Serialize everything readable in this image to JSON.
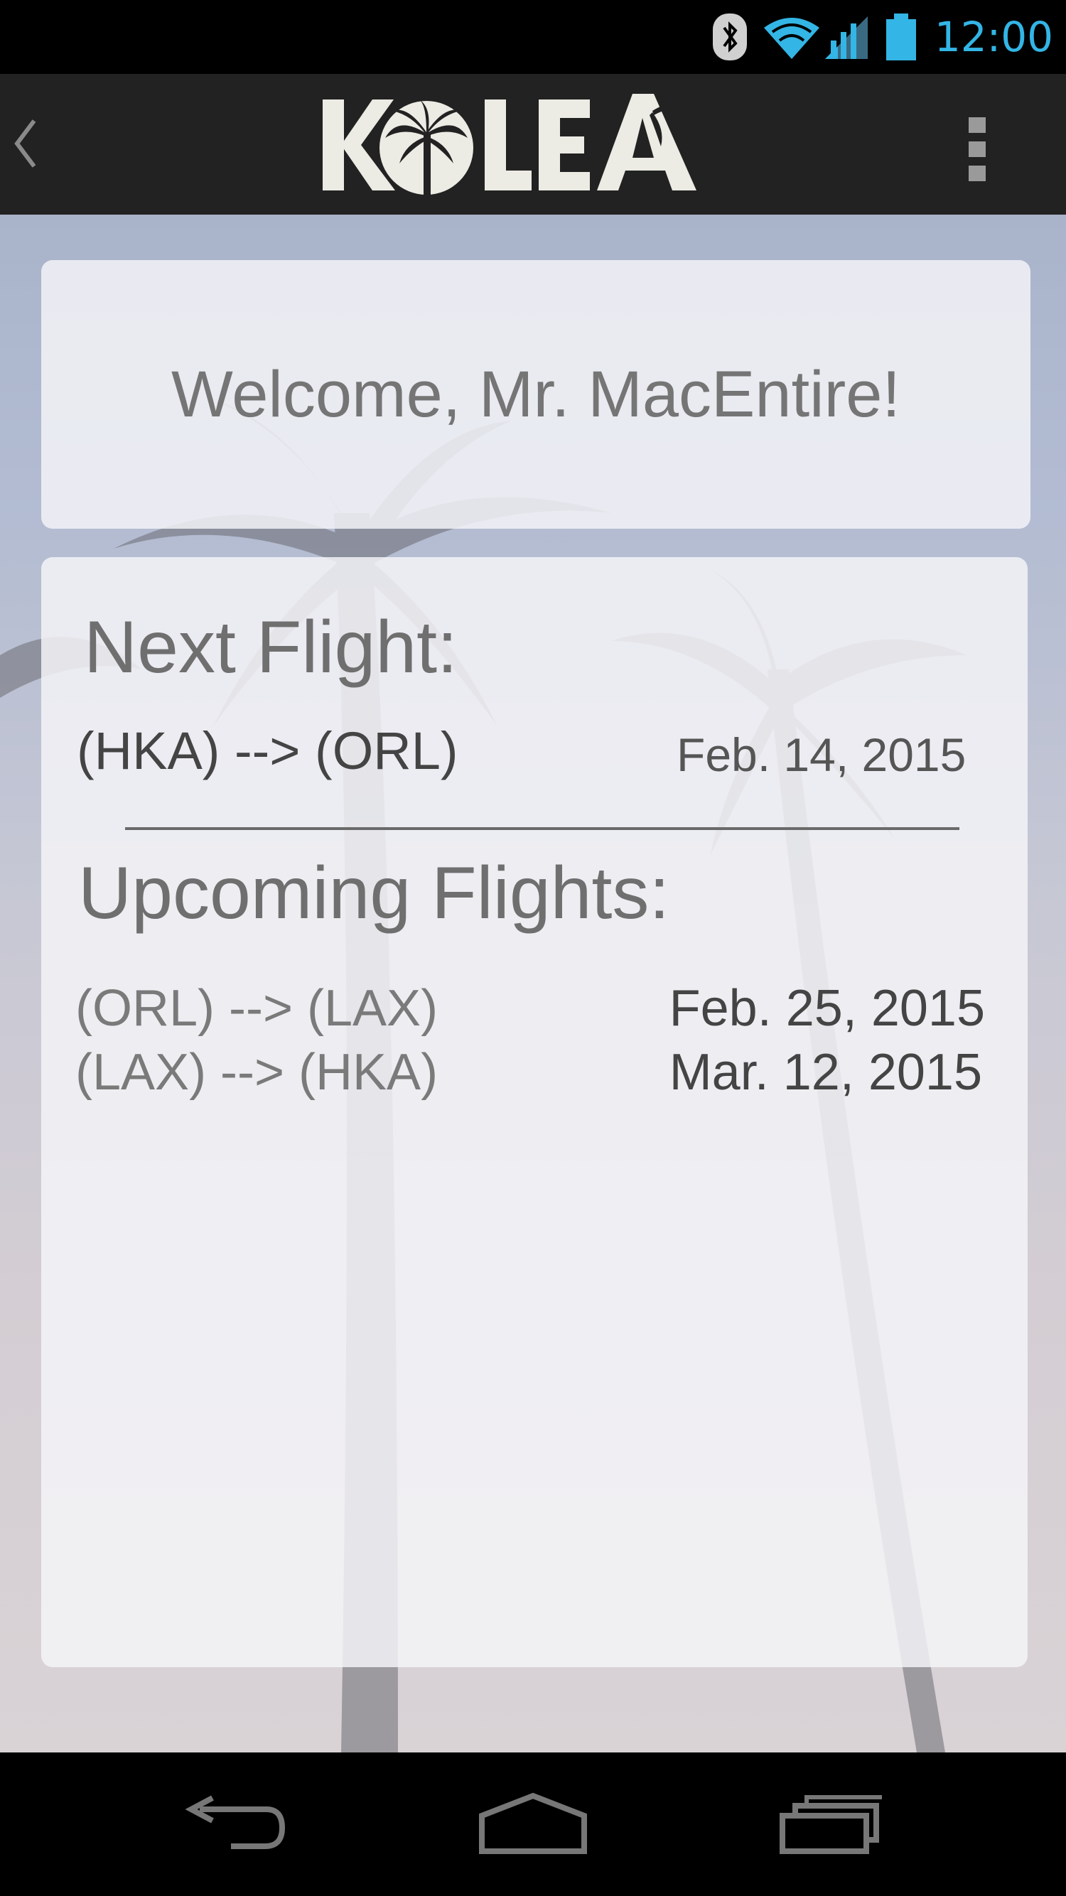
{
  "status_bar": {
    "time": "12:00",
    "icons": [
      "bluetooth-icon",
      "wifi-icon",
      "signal-icon",
      "battery-icon"
    ],
    "accent_color": "#33b5e5"
  },
  "action_bar": {
    "logo_text": "KOLEA",
    "back_icon": "chevron-left-icon",
    "menu_icon": "overflow-menu-icon"
  },
  "welcome": {
    "message": "Welcome, Mr. MacEntire!"
  },
  "next_flight": {
    "title": "Next Flight:",
    "route": "(HKA) --> (ORL)",
    "date": "Feb. 14, 2015"
  },
  "upcoming_flights": {
    "title": "Upcoming Flights:",
    "items": [
      {
        "route": "(ORL) --> (LAX)",
        "date": "Feb. 25, 2015"
      },
      {
        "route": "(LAX) --> (HKA)",
        "date": "Mar. 12, 2015"
      }
    ]
  },
  "nav_bar": {
    "buttons": [
      "back-icon",
      "home-icon",
      "recent-apps-icon"
    ]
  }
}
